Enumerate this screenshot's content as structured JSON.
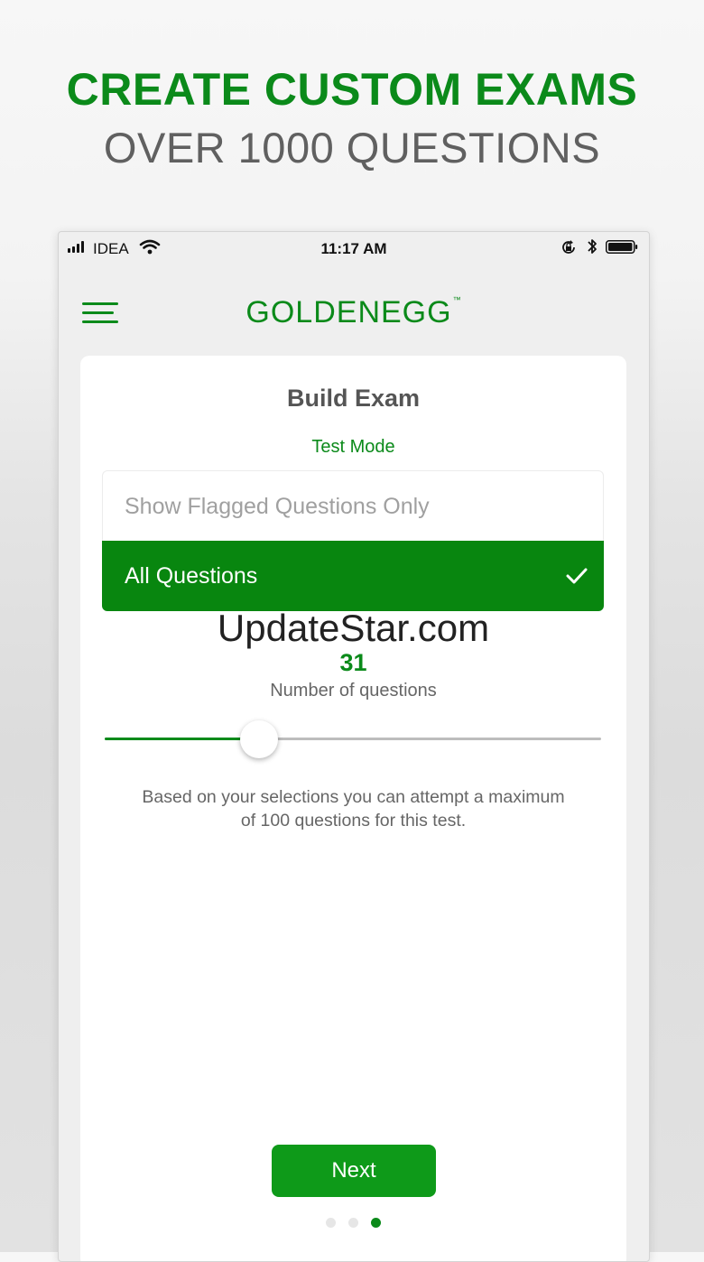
{
  "promo": {
    "title": "CREATE CUSTOM EXAMS",
    "subtitle": "OVER 1000 QUESTIONS"
  },
  "status_bar": {
    "carrier": "IDEA",
    "time": "11:17 AM",
    "icons": [
      "signal-icon",
      "wifi-icon",
      "rotation-lock-icon",
      "bluetooth-icon",
      "battery-icon"
    ]
  },
  "header": {
    "menu_icon": "hamburger-menu-icon",
    "logo_text": "GOLDENEGG",
    "logo_tm": "™"
  },
  "card": {
    "title": "Build Exam",
    "mode_label": "Test Mode",
    "options": [
      {
        "label": "Show Flagged Questions Only",
        "selected": false
      },
      {
        "label": "All Questions",
        "selected": true
      }
    ],
    "watermark": "UpdateStar.com",
    "question_count": "31",
    "question_count_label": "Number of questions",
    "slider": {
      "value": 31,
      "max": 100
    },
    "info_text": "Based on your selections you can attempt a maximum of 100 questions for this test.",
    "next_label": "Next",
    "page_dots": {
      "count": 3,
      "active": 3
    }
  },
  "colors": {
    "brand_green": "#0b8a1a",
    "selected_green": "#08860f",
    "button_green": "#0e9a19",
    "dot_inactive": "#e6e6e6",
    "text_gray": "#606060"
  }
}
